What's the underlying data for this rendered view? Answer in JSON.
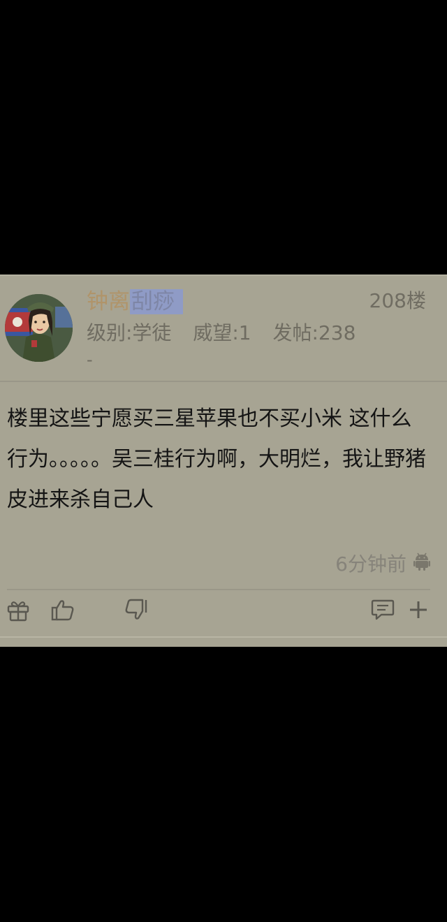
{
  "post": {
    "username_part1": "钟离",
    "username_part2": "刮痧",
    "floor": "208楼",
    "level": "级别:学徒",
    "prestige": "威望:1",
    "posts": "发帖:238",
    "dash": "-",
    "content": "楼里这些宁愿买三星苹果也不买小米 这什么行为。。。。。吴三桂行为啊，大明烂，我让野猪皮进来杀自己人",
    "time": "6分钟前",
    "device_icon": "android-icon"
  },
  "actions": [
    {
      "icon": "gift-icon"
    },
    {
      "icon": "thumbs-up-icon"
    },
    {
      "icon": "thumbs-down-icon"
    },
    {
      "icon": "comment-icon"
    },
    {
      "icon": "plus-icon"
    }
  ],
  "colors": {
    "card_background": "#a7a493",
    "username": "#b0946a",
    "highlight": "#8f9bc6"
  }
}
